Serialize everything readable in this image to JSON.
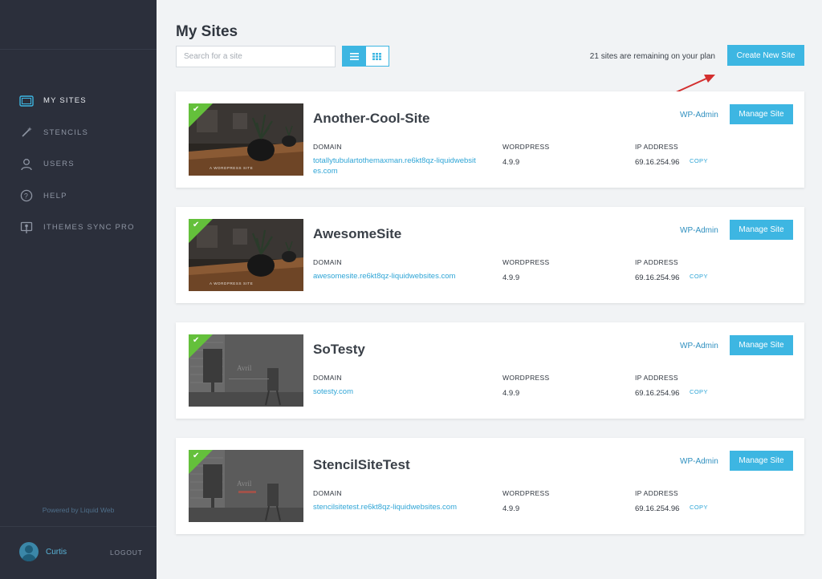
{
  "sidebar": {
    "items": [
      {
        "label": "MY SITES",
        "icon": "sites-icon"
      },
      {
        "label": "STENCILS",
        "icon": "wand-icon"
      },
      {
        "label": "USERS",
        "icon": "user-icon"
      },
      {
        "label": "HELP",
        "icon": "help-icon"
      },
      {
        "label": "ITHEMES SYNC PRO",
        "icon": "sync-icon"
      }
    ],
    "powered_by": "Powered by Liquid Web",
    "user_name": "Curtis",
    "logout_label": "LOGOUT"
  },
  "header": {
    "title": "My Sites",
    "search_placeholder": "Search for a site",
    "remaining_text": "21 sites are remaining on your plan",
    "create_label": "Create New Site"
  },
  "labels": {
    "domain": "DOMAIN",
    "wordpress": "WORDPRESS",
    "ip": "IP ADDRESS",
    "copy": "COPY",
    "wp_admin": "WP-Admin",
    "manage": "Manage Site"
  },
  "sites": [
    {
      "name": "Another-Cool-Site",
      "domain": "totallytubulartothemaxman.re6kt8qz-liquidwebsites.com",
      "wp_version": "4.9.9",
      "ip": "69.16.254.96",
      "thumb_caption": "A WORDPRESS SITE"
    },
    {
      "name": "AwesomeSite",
      "domain": "awesomesite.re6kt8qz-liquidwebsites.com",
      "wp_version": "4.9.9",
      "ip": "69.16.254.96",
      "thumb_caption": "A WORDPRESS SITE"
    },
    {
      "name": "SoTesty",
      "domain": "sotesty.com",
      "wp_version": "4.9.9",
      "ip": "69.16.254.96",
      "thumb_caption": "Avril"
    },
    {
      "name": "StencilSiteTest",
      "domain": "stencilsitetest.re6kt8qz-liquidwebsites.com",
      "wp_version": "4.9.9",
      "ip": "69.16.254.96",
      "thumb_caption": "Avril"
    }
  ],
  "colors": {
    "accent": "#3db6e2",
    "sidebar_bg": "#2b2f3b",
    "success": "#64c03b",
    "annotation_arrow": "#d32f2f"
  }
}
